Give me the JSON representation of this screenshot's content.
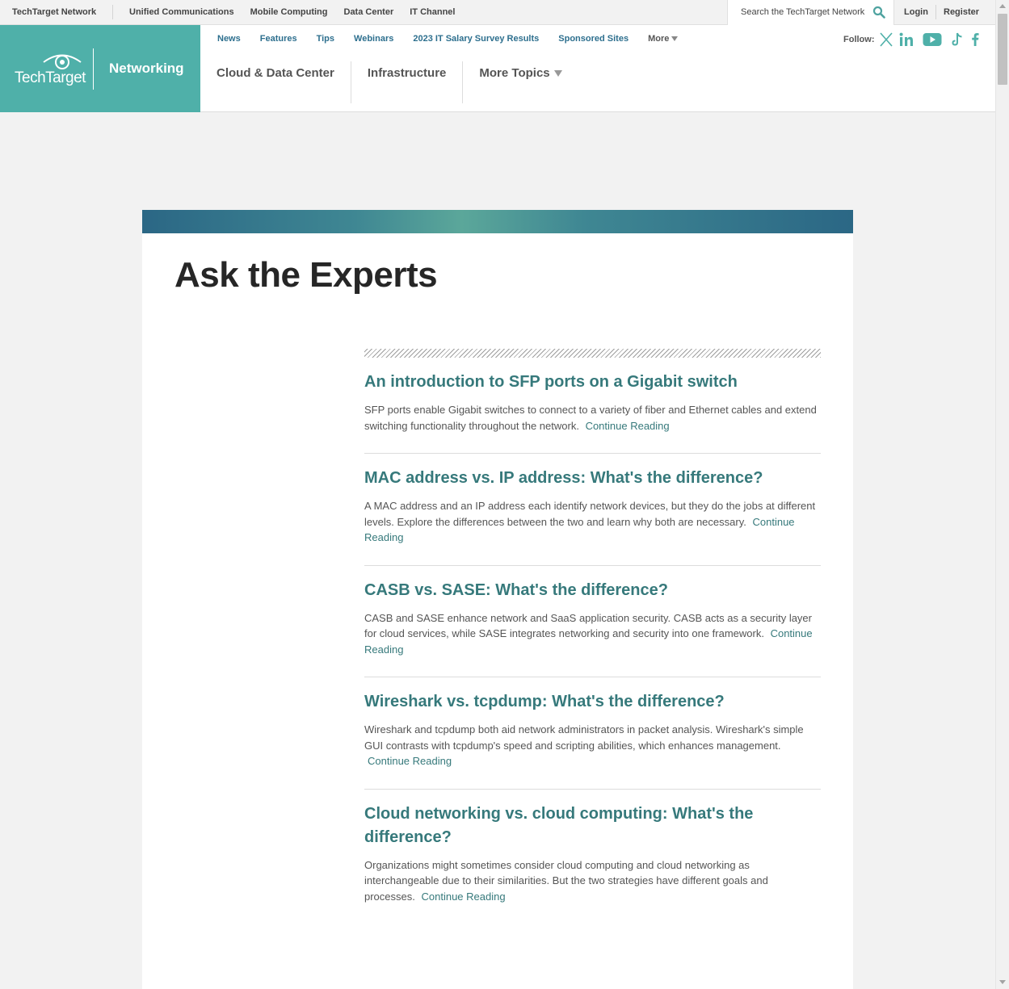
{
  "netbar": {
    "brand": "TechTarget Network",
    "links": [
      "Unified Communications",
      "Mobile Computing",
      "Data Center",
      "IT Channel"
    ],
    "search_placeholder": "Search the TechTarget Network",
    "login": "Login",
    "register": "Register"
  },
  "header": {
    "logo_text": "TechTarget",
    "site_name": "Networking",
    "subnav": [
      "News",
      "Features",
      "Tips",
      "Webinars",
      "2023 IT Salary Survey Results",
      "Sponsored Sites"
    ],
    "subnav_more": "More",
    "topics": [
      "Cloud & Data Center",
      "Infrastructure"
    ],
    "topics_more": "More Topics",
    "follow_label": "Follow:",
    "social_icons": [
      "x-icon",
      "linkedin-icon",
      "youtube-icon",
      "tiktok-icon",
      "facebook-icon"
    ]
  },
  "colors": {
    "brand_teal": "#4fb0a9",
    "link_teal": "#36797b",
    "nav_blue": "#2d6f8e"
  },
  "main": {
    "title": "Ask the Experts",
    "articles": [
      {
        "title": "An introduction to SFP ports on a Gigabit switch",
        "desc": "SFP ports enable Gigabit switches to connect to a variety of fiber and Ethernet cables and extend switching functionality throughout the network.",
        "cta": "Continue Reading"
      },
      {
        "title": "MAC address vs. IP address: What's the difference?",
        "desc": "A MAC address and an IP address each identify network devices, but they do the jobs at different levels. Explore the differences between the two and learn why both are necessary.",
        "cta": "Continue Reading"
      },
      {
        "title": "CASB vs. SASE: What's the difference?",
        "desc": "CASB and SASE enhance network and SaaS application security. CASB acts as a security layer for cloud services, while SASE integrates networking and security into one framework.",
        "cta": "Continue Reading"
      },
      {
        "title": "Wireshark vs. tcpdump: What's the difference?",
        "desc": "Wireshark and tcpdump both aid network administrators in packet analysis. Wireshark's simple GUI contrasts with tcpdump's speed and scripting abilities, which enhances management.",
        "cta": "Continue Reading"
      },
      {
        "title": "Cloud networking vs. cloud computing: What's the difference?",
        "desc": "Organizations might sometimes consider cloud computing and cloud networking as interchangeable due to their similarities. But the two strategies have different goals and processes.",
        "cta": "Continue Reading"
      }
    ]
  }
}
